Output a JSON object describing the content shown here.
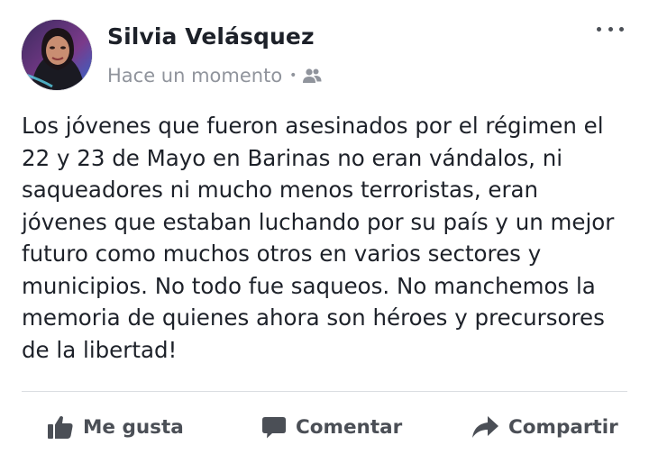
{
  "post": {
    "author": "Silvia Velásquez",
    "timestamp": "Hace un momento",
    "separator": "•",
    "audience_icon": "friends-icon",
    "more_icon": "more-options-icon",
    "text": "Los jóvenes que fueron asesinados por el régimen el\n22 y 23 de Mayo en Barinas no eran vándalos, ni\nsaqueadores ni mucho menos terroristas, eran\njóvenes que estaban luchando por su país y un mejor\nfuturo como muchos otros en varios sectores y\nmunicipios. No todo fue saqueos. No manchemos la\nmemoria de quienes ahora son héroes y precursores\nde la libertad!"
  },
  "actions": {
    "like_label": "Me gusta",
    "comment_label": "Comentar",
    "share_label": "Compartir"
  },
  "colors": {
    "text": "#1d2129",
    "secondary": "#90949c",
    "action": "#4b4f56",
    "divider": "#dadde1"
  }
}
